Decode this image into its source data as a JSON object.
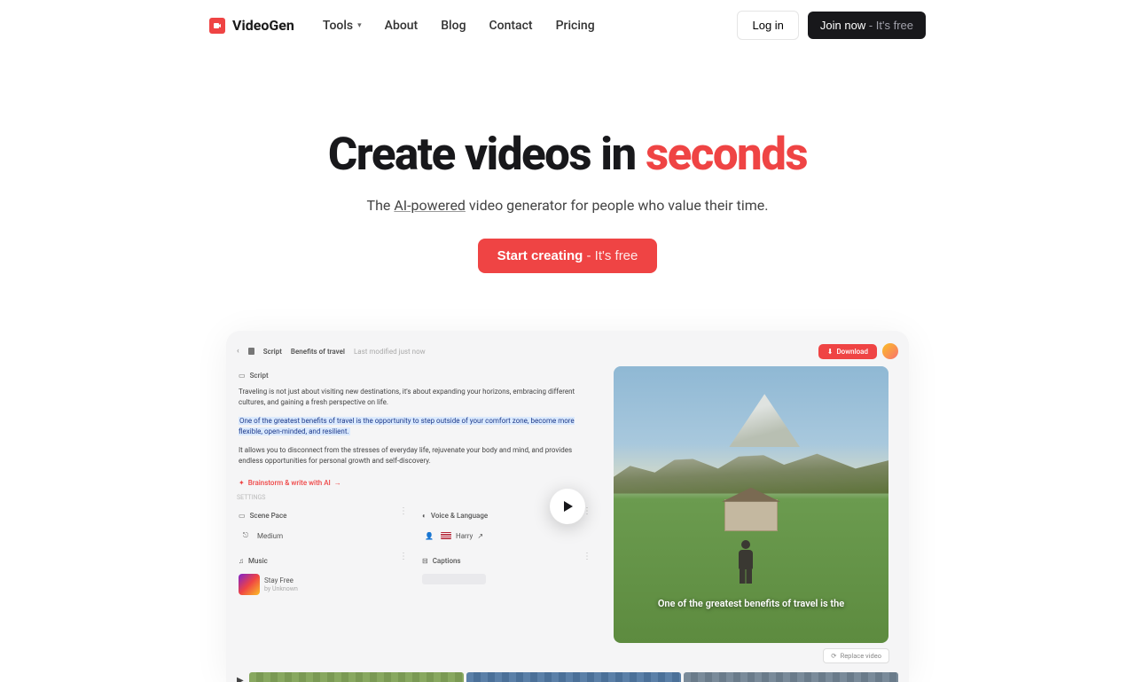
{
  "brand": "VideoGen",
  "nav": {
    "tools": "Tools",
    "about": "About",
    "blog": "Blog",
    "contact": "Contact",
    "pricing": "Pricing"
  },
  "header": {
    "login": "Log in",
    "join_main": "Join now",
    "join_sub": " - It's free"
  },
  "hero": {
    "title_pre": "Create videos in ",
    "title_accent": "seconds",
    "subtitle_pre": "The ",
    "subtitle_link": "AI-powered",
    "subtitle_post": " video generator for people who value their time.",
    "cta_main": "Start creating",
    "cta_sub": " - It's free"
  },
  "demo": {
    "breadcrumb_script": "Script",
    "breadcrumb_title": "Benefits of travel",
    "last_modified": "Last modified just now",
    "download": "Download",
    "script_label": "Script",
    "script_p1": "Traveling is not just about visiting new destinations, it's about expanding your horizons, embracing different cultures, and gaining a fresh perspective on life.",
    "script_p2": "One of the greatest benefits of travel is the opportunity to step outside of your comfort zone, become more flexible, open-minded, and resilient.",
    "script_p3": "It allows you to disconnect from the stresses of everyday life, rejuvenate your body and mind, and provides endless opportunities for personal growth and self-discovery.",
    "ai_link": "Brainstorm & write with AI",
    "sep_label": "SETTINGS",
    "scene_pace_label": "Scene Pace",
    "scene_pace_value": "Medium",
    "voice_label": "Voice & Language",
    "voice_value": "Harry",
    "music_label": "Music",
    "music_title": "Stay Free",
    "music_artist": "by Unknown",
    "captions_label": "Captions",
    "caption_overlay": "One of the greatest benefits of travel is the",
    "replace_video": "Replace video"
  }
}
